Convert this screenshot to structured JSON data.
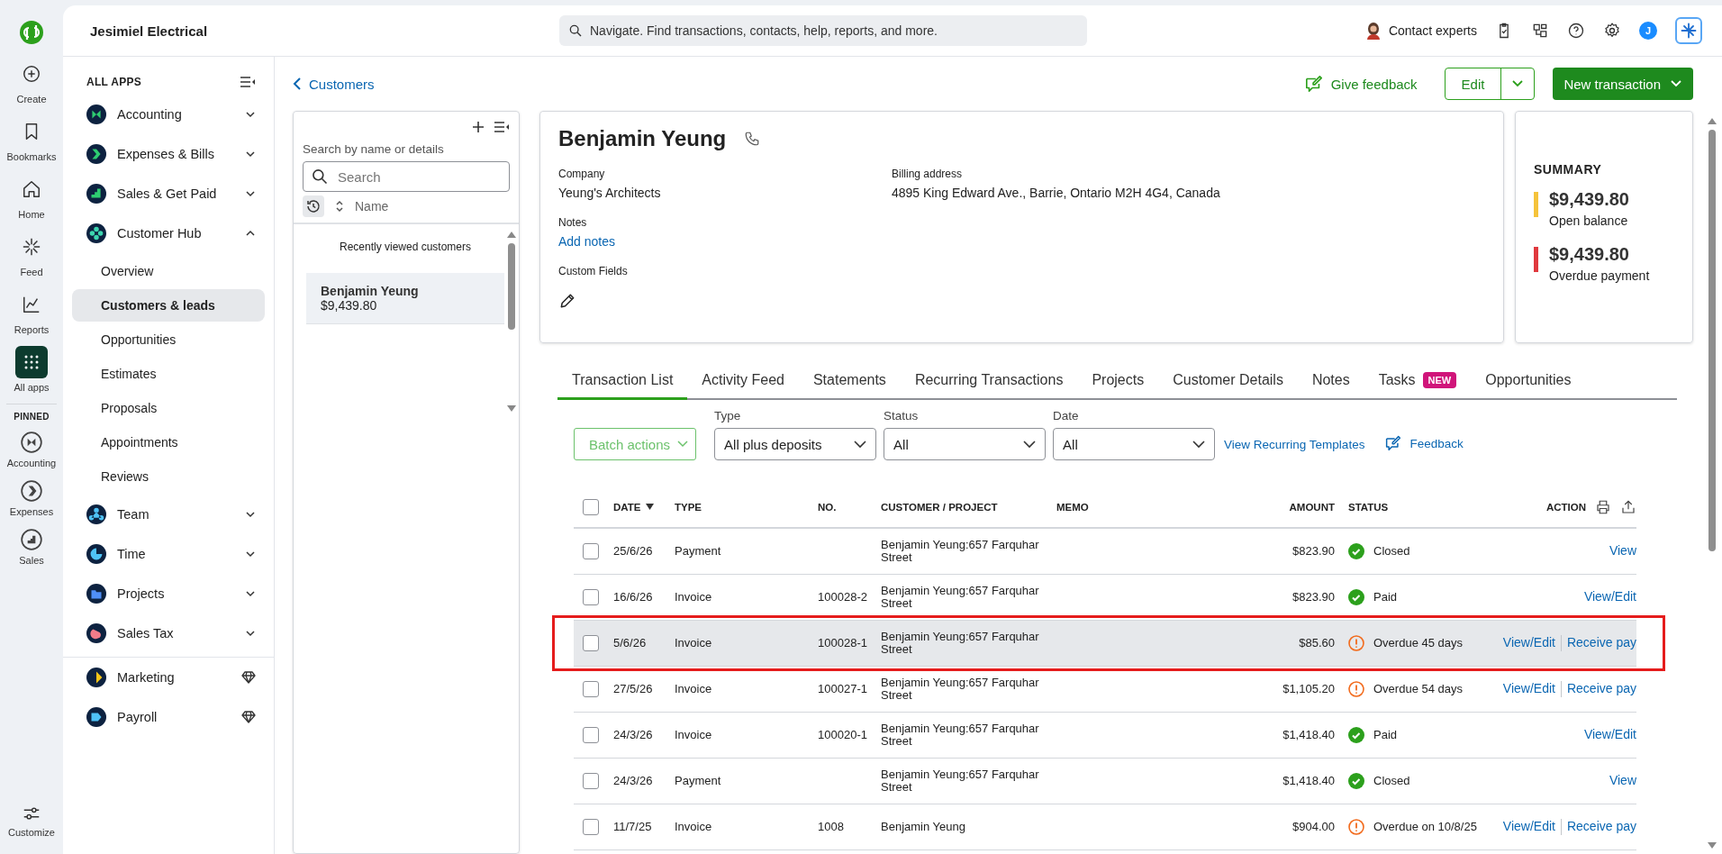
{
  "rail": {
    "items": [
      {
        "label": "Create",
        "selected": false
      },
      {
        "label": "Bookmarks",
        "selected": false
      },
      {
        "label": "Home",
        "selected": false
      },
      {
        "label": "Feed",
        "selected": false
      },
      {
        "label": "Reports",
        "selected": false
      },
      {
        "label": "All apps",
        "selected": true
      }
    ],
    "pinned_label": "PINNED",
    "pinned": [
      {
        "label": "Accounting"
      },
      {
        "label": "Expenses"
      },
      {
        "label": "Sales"
      }
    ],
    "customize": "Customize"
  },
  "company": "Jesimiel Electrical",
  "sidebar": {
    "title": "ALL APPS",
    "apps": [
      {
        "label": "Accounting",
        "expanded": false
      },
      {
        "label": "Expenses & Bills",
        "expanded": false
      },
      {
        "label": "Sales & Get Paid",
        "expanded": false
      },
      {
        "label": "Customer Hub",
        "expanded": true,
        "children": [
          {
            "label": "Overview",
            "selected": false
          },
          {
            "label": "Customers & leads",
            "selected": true
          },
          {
            "label": "Opportunities",
            "selected": false
          },
          {
            "label": "Estimates",
            "selected": false
          },
          {
            "label": "Proposals",
            "selected": false
          },
          {
            "label": "Appointments",
            "selected": false
          },
          {
            "label": "Reviews",
            "selected": false
          }
        ]
      },
      {
        "label": "Team",
        "expanded": false
      },
      {
        "label": "Time",
        "expanded": false
      },
      {
        "label": "Projects",
        "expanded": false
      },
      {
        "label": "Sales Tax",
        "expanded": false
      }
    ],
    "premium": [
      {
        "label": "Marketing"
      },
      {
        "label": "Payroll"
      }
    ]
  },
  "topbar": {
    "search_placeholder": "Navigate. Find transactions, contacts, help, reports, and more.",
    "contact": "Contact experts",
    "avatar": "J"
  },
  "back_link": "Customers",
  "actions": {
    "feedback": "Give feedback",
    "edit": "Edit",
    "new": "New transaction"
  },
  "customer_list": {
    "search_label": "Search by name or details",
    "search_placeholder": "Search",
    "sort_label": "Name",
    "recent_label": "Recently viewed customers",
    "items": [
      {
        "name": "Benjamin Yeung",
        "balance": "$9,439.80",
        "selected": true
      }
    ]
  },
  "customer": {
    "name": "Benjamin Yeung",
    "company_label": "Company",
    "company": "Yeung's Architects",
    "billing_label": "Billing address",
    "billing": "4895 King Edward Ave., Barrie, Ontario M2H 4G4, Canada",
    "notes_label": "Notes",
    "notes_link": "Add notes",
    "custom_label": "Custom Fields"
  },
  "summary": {
    "title": "SUMMARY",
    "items": [
      {
        "amount": "$9,439.80",
        "label": "Open balance",
        "color": "#f5c33b"
      },
      {
        "amount": "$9,439.80",
        "label": "Overdue payment",
        "color": "#e0393e"
      }
    ]
  },
  "tabs": [
    {
      "label": "Transaction List",
      "selected": true
    },
    {
      "label": "Activity Feed",
      "selected": false
    },
    {
      "label": "Statements",
      "selected": false
    },
    {
      "label": "Recurring Transactions",
      "selected": false
    },
    {
      "label": "Projects",
      "selected": false
    },
    {
      "label": "Customer Details",
      "selected": false
    },
    {
      "label": "Notes",
      "selected": false
    },
    {
      "label": "Tasks",
      "selected": false,
      "badge": "NEW"
    },
    {
      "label": "Opportunities",
      "selected": false
    }
  ],
  "filters": {
    "batch": "Batch actions",
    "dropdowns": [
      {
        "label": "Type",
        "value": "All plus deposits"
      },
      {
        "label": "Status",
        "value": "All"
      },
      {
        "label": "Date",
        "value": "All"
      }
    ],
    "templates_link": "View Recurring Templates",
    "feedback_link": "Feedback"
  },
  "table": {
    "all_checked": false,
    "columns": [
      {
        "label": "DATE",
        "sorted": true
      },
      {
        "label": "TYPE",
        "sorted": false
      },
      {
        "label": "NO.",
        "sorted": false
      },
      {
        "label": "CUSTOMER / PROJECT",
        "sorted": false
      },
      {
        "label": "MEMO",
        "sorted": false
      },
      {
        "label": "AMOUNT",
        "sorted": false
      },
      {
        "label": "STATUS",
        "sorted": false
      },
      {
        "label": "ACTION",
        "sorted": false
      }
    ],
    "rows": [
      {
        "date": "25/6/26",
        "type": "Payment",
        "customer": "Benjamin Yeung:657 Farquhar Street",
        "amount": "$823.90",
        "status": {
          "kind": "ok",
          "text": "Closed"
        },
        "actions": [
          "View"
        ],
        "checked": false,
        "highlighted": false
      },
      {
        "date": "16/6/26",
        "type": "Invoice",
        "no": "100028-2",
        "customer": "Benjamin Yeung:657 Farquhar Street",
        "amount": "$823.90",
        "status": {
          "kind": "ok",
          "text": "Paid"
        },
        "actions": [
          "View/Edit"
        ],
        "checked": false,
        "highlighted": false
      },
      {
        "date": "5/6/26",
        "type": "Invoice",
        "no": "100028-1",
        "customer": "Benjamin Yeung:657 Farquhar Street",
        "amount": "$85.60",
        "status": {
          "kind": "overdue",
          "text": "Overdue 45 days"
        },
        "actions": [
          "View/Edit",
          "Receive pay"
        ],
        "checked": false,
        "highlighted": true
      },
      {
        "date": "27/5/26",
        "type": "Invoice",
        "no": "100027-1",
        "customer": "Benjamin Yeung:657 Farquhar Street",
        "amount": "$1,105.20",
        "status": {
          "kind": "overdue",
          "text": "Overdue 54 days"
        },
        "actions": [
          "View/Edit",
          "Receive pay"
        ],
        "checked": false,
        "highlighted": false
      },
      {
        "date": "24/3/26",
        "type": "Invoice",
        "no": "100020-1",
        "customer": "Benjamin Yeung:657 Farquhar Street",
        "amount": "$1,418.40",
        "status": {
          "kind": "ok",
          "text": "Paid"
        },
        "actions": [
          "View/Edit"
        ],
        "checked": false,
        "highlighted": false
      },
      {
        "date": "24/3/26",
        "type": "Payment",
        "customer": "Benjamin Yeung:657 Farquhar Street",
        "amount": "$1,418.40",
        "status": {
          "kind": "ok",
          "text": "Closed"
        },
        "actions": [
          "View"
        ],
        "checked": false,
        "highlighted": false
      },
      {
        "date": "11/7/25",
        "type": "Invoice",
        "no": "1008",
        "customer": "Benjamin Yeung",
        "amount": "$904.00",
        "status": {
          "kind": "overdue",
          "text": "Overdue on 10/8/25"
        },
        "actions": [
          "View/Edit",
          "Receive pay"
        ],
        "checked": false,
        "highlighted": false
      }
    ]
  }
}
